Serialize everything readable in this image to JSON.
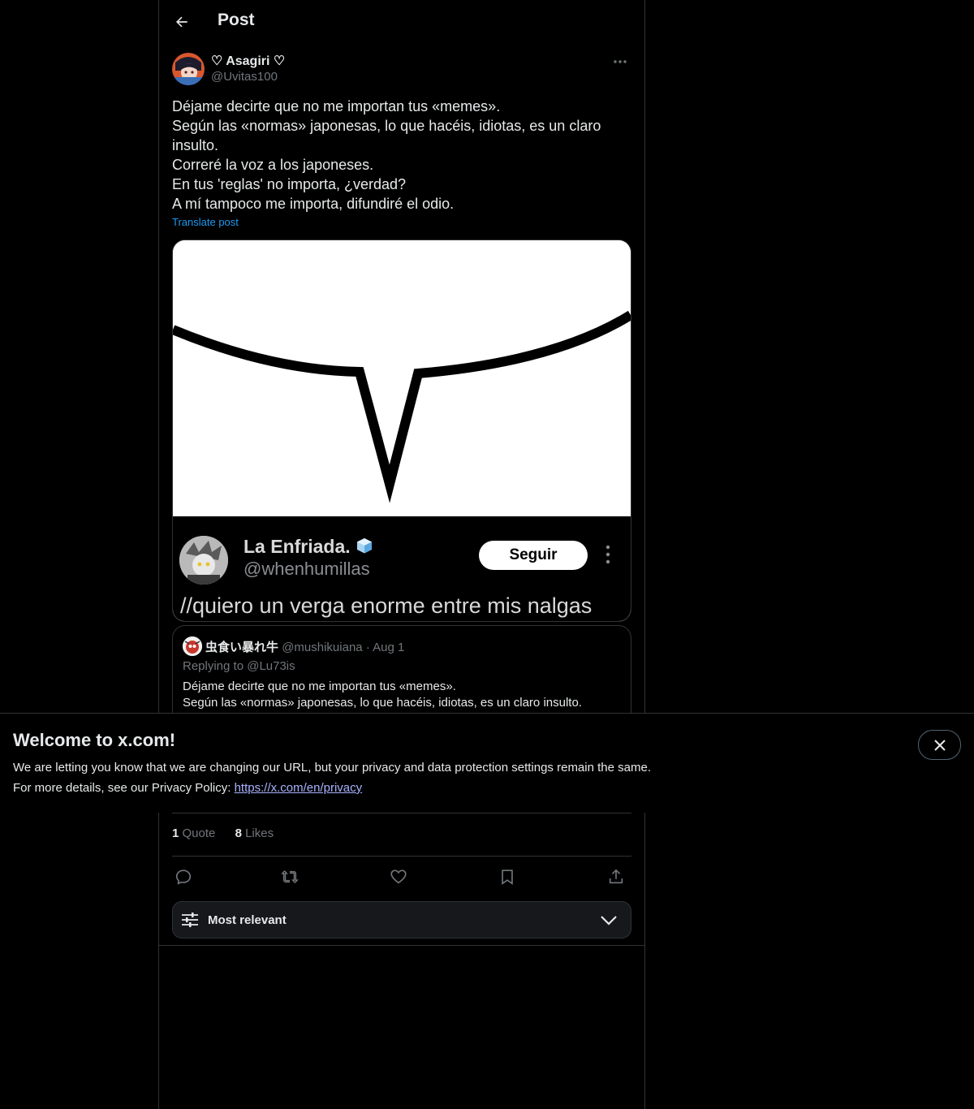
{
  "header": {
    "title": "Post"
  },
  "post": {
    "author_name": "♡ Asagiri ♡",
    "author_handle": "@Uvitas100",
    "text_lines": [
      "Déjame decirte que no me importan tus «memes».",
      "Según las «normas» japonesas, lo que hacéis, idiotas, es un claro",
      "insulto.",
      "Correré la voz a los japoneses.",
      "En tus 'reglas' no importa, ¿verdad?",
      "A mí tampoco me importa, difundiré el odio."
    ],
    "translate_label": "Translate post"
  },
  "media_card": {
    "name": "La Enfriada.",
    "handle": "@whenhumillas",
    "follow_label": "Seguir",
    "caption": "//quiero un verga enorme entre mis nalgas"
  },
  "quoted_post": {
    "author_name": "虫食い暴れ牛",
    "author_handle": "@mushikuiana",
    "separator": "·",
    "date": "Aug 1",
    "replying_to": "Replying to @Lu73is",
    "text_lines": [
      "Déjame decirte que no me importan tus «memes».",
      "Según las «normas» japonesas, lo que hacéis, idiotas, es un claro insulto."
    ]
  },
  "stats": {
    "quotes_count": "1",
    "quotes_label": "Quote",
    "likes_count": "8",
    "likes_label": "Likes"
  },
  "actions": [
    "reply-icon",
    "repost-icon",
    "like-icon",
    "bookmark-icon",
    "share-icon"
  ],
  "sort": {
    "label": "Most relevant"
  },
  "banner": {
    "title": "Welcome to x.com!",
    "line1": "We are letting you know that we are changing our URL, but your privacy and data protection settings remain the same.",
    "line2_prefix": "For more details, see our Privacy Policy: ",
    "link_text": "https://x.com/en/privacy"
  },
  "colors": {
    "background": "#000000",
    "text_primary": "#e7e9ea",
    "text_secondary": "#71767b",
    "accent_blue": "#1d9bf0",
    "border": "#2f3336",
    "link": "#a8b3ff"
  }
}
